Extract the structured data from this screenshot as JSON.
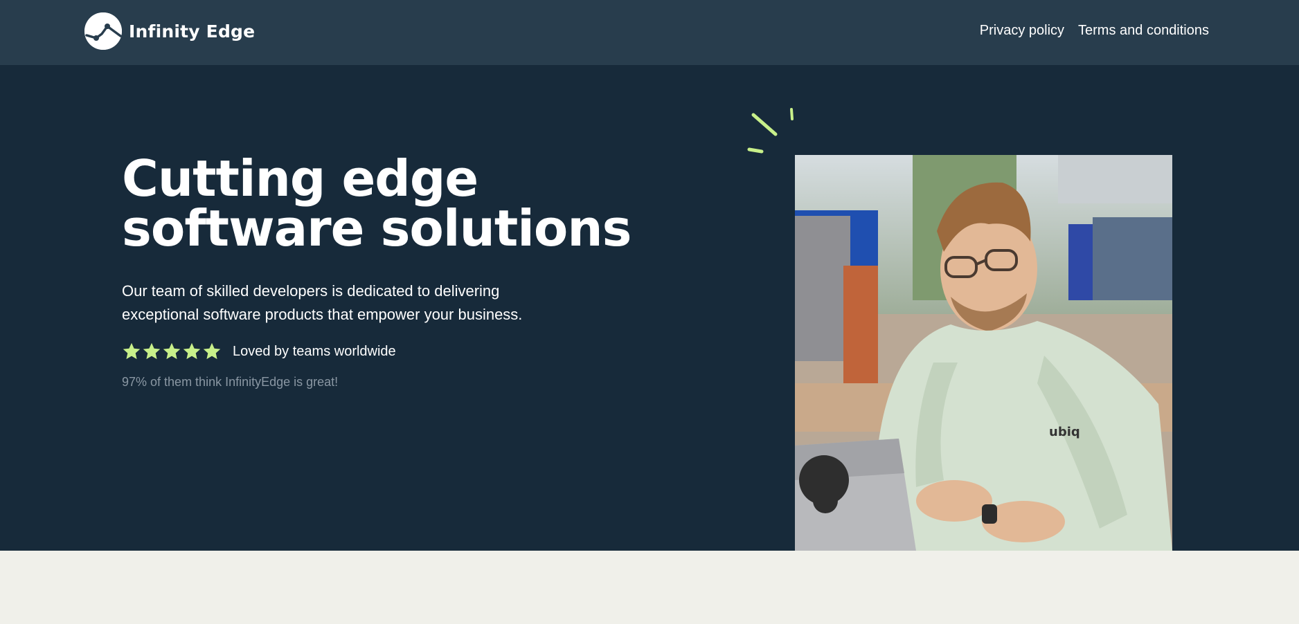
{
  "header": {
    "brand": "Infinity Edge",
    "logo_icon": "infinity-edge-logo-icon",
    "nav": [
      {
        "label": "Privacy policy"
      },
      {
        "label": "Terms and conditions"
      }
    ]
  },
  "hero": {
    "headline_line1": "Cutting edge",
    "headline_line2": "software solutions",
    "description": "Our team of skilled developers is dedicated to delivering exceptional software products that empower your business.",
    "rating": {
      "stars": 5,
      "label": "Loved by teams worldwide",
      "note": "97% of them think InfinityEdge is great!"
    },
    "image": "developer-at-laptop-photo"
  },
  "colors": {
    "header_bg": "#283d4d",
    "hero_bg": "#172a3a",
    "accent": "#c8f08a",
    "lower_bg": "#f0f0ea"
  }
}
